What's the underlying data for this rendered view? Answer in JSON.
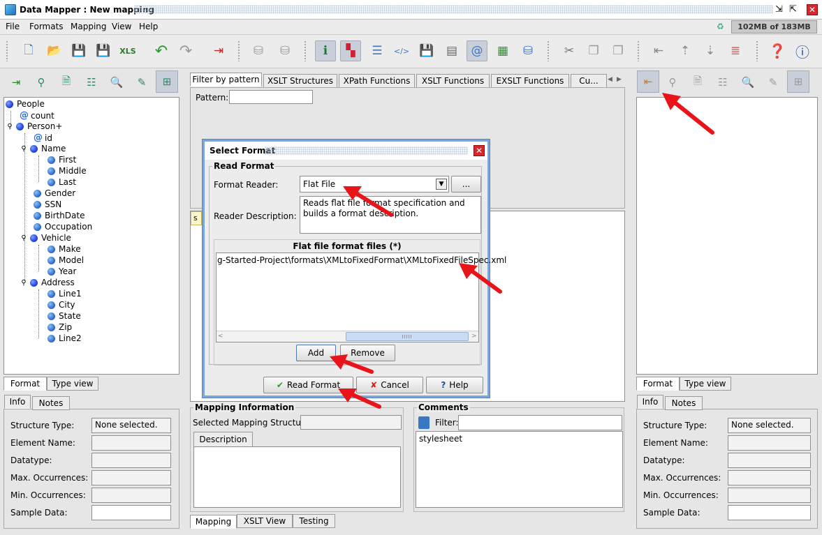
{
  "window": {
    "title": "Data Mapper : New mapping",
    "memory": "102MB of 183MB"
  },
  "menu": {
    "items": [
      "File",
      "Formats",
      "Mapping",
      "View",
      "Help"
    ]
  },
  "icons": {
    "app": "data-mapper-app-icon",
    "toolbar": [
      "new-file-icon",
      "open-file-icon",
      "save-icon",
      "save-as-icon",
      "export-xls-icon",
      "undo-icon",
      "redo-icon",
      "exit-icon",
      "db-read-icon",
      "db-write-icon",
      "info-icon",
      "palette-icon",
      "table-icon",
      "xsl-icon",
      "save-database-icon",
      "list-icon",
      "xpath-icon",
      "grid-icon",
      "database-icon",
      "cut-icon",
      "copy-icon",
      "paste-icon",
      "move-left-icon",
      "move-up-icon",
      "move-down-icon",
      "stack-icon",
      "help-icon",
      "about-icon"
    ]
  },
  "left": {
    "tree": [
      {
        "label": "People",
        "kind": "root"
      },
      {
        "label": "count",
        "kind": "attr"
      },
      {
        "label": "Person+",
        "kind": "group"
      },
      {
        "label": "id",
        "kind": "attr"
      },
      {
        "label": "Name",
        "kind": "group"
      },
      {
        "label": "First",
        "kind": "leaf"
      },
      {
        "label": "Middle",
        "kind": "leaf"
      },
      {
        "label": "Last",
        "kind": "leaf"
      },
      {
        "label": "Gender",
        "kind": "leaf"
      },
      {
        "label": "SSN",
        "kind": "leaf"
      },
      {
        "label": "BirthDate",
        "kind": "leaf"
      },
      {
        "label": "Occupation",
        "kind": "leaf"
      },
      {
        "label": "Vehicle",
        "kind": "group"
      },
      {
        "label": "Make",
        "kind": "leaf"
      },
      {
        "label": "Model",
        "kind": "leaf"
      },
      {
        "label": "Year",
        "kind": "leaf"
      },
      {
        "label": "Address",
        "kind": "group"
      },
      {
        "label": "Line1",
        "kind": "leaf"
      },
      {
        "label": "City",
        "kind": "leaf"
      },
      {
        "label": "State",
        "kind": "leaf"
      },
      {
        "label": "Zip",
        "kind": "leaf"
      },
      {
        "label": "Line2",
        "kind": "leaf"
      }
    ],
    "tabs": [
      "Format",
      "Type view"
    ],
    "infotabs": [
      "Info",
      "Notes"
    ],
    "props": [
      {
        "label": "Structure Type:",
        "value": "None selected."
      },
      {
        "label": "Element Name:",
        "value": ""
      },
      {
        "label": "Datatype:",
        "value": ""
      },
      {
        "label": "Max. Occurrences:",
        "value": ""
      },
      {
        "label": "Min. Occurrences:",
        "value": ""
      },
      {
        "label": "Sample Data:",
        "value": ""
      }
    ]
  },
  "center": {
    "tabs": [
      "Filter by pattern",
      "XSLT Structures",
      "XPath Functions",
      "XSLT Functions",
      "EXSLT Functions",
      "Cu..."
    ],
    "pattern_label": "Pattern:",
    "pattern_value": "",
    "lower_tab": "s",
    "mapping_info": {
      "title": "Mapping Information",
      "selected_label": "Selected Mapping Structure:",
      "selected_value": "",
      "desc_tab": "Description"
    },
    "comments": {
      "title": "Comments",
      "filter_label": "Filter:",
      "filter_value": "",
      "items": [
        "stylesheet"
      ]
    },
    "bottom_tabs": [
      "Mapping",
      "XSLT View",
      "Testing"
    ]
  },
  "right": {
    "tabs": [
      "Format",
      "Type view"
    ],
    "infotabs": [
      "Info",
      "Notes"
    ],
    "props": [
      {
        "label": "Structure Type:",
        "value": "None selected."
      },
      {
        "label": "Element Name:",
        "value": ""
      },
      {
        "label": "Datatype:",
        "value": ""
      },
      {
        "label": "Max. Occurrences:",
        "value": ""
      },
      {
        "label": "Min. Occurrences:",
        "value": ""
      },
      {
        "label": "Sample Data:",
        "value": ""
      }
    ]
  },
  "dialog": {
    "title": "Select Format",
    "group_title": "Read Format",
    "reader_label": "Format Reader:",
    "reader_value": "Flat File",
    "browse_label": "...",
    "desc_label": "Reader Description:",
    "desc_value": "Reads flat file format specification and builds a format description.",
    "files_header": "Flat file format files (*)",
    "files": [
      "g-Started-Project\\formats\\XMLtoFixedFormat\\XMLtoFixedFileSpec.xml"
    ],
    "scroll_grip": "IIIII",
    "add_label": "Add",
    "remove_label": "Remove",
    "read_label": "Read Format",
    "cancel_label": "Cancel",
    "help_label": "Help"
  },
  "colors": {
    "accent_border": "#7aa6da",
    "annotation_arrow": "#e8141a",
    "tree_dot": "#2c6ac8"
  }
}
